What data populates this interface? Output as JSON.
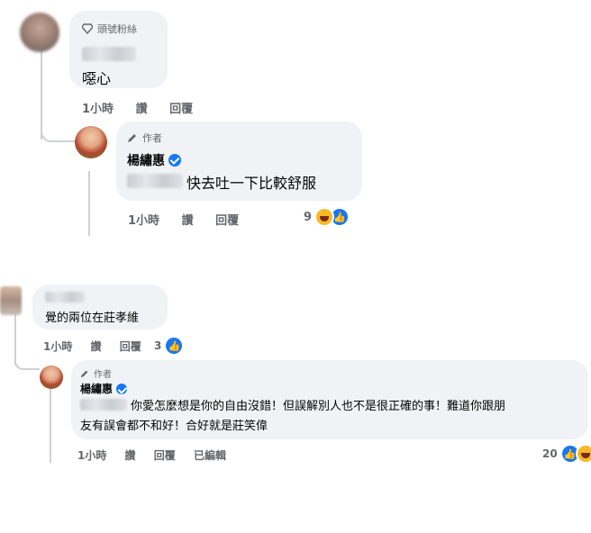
{
  "thread1": {
    "commenter": {
      "badge": "頭號粉絲",
      "text": "噁心",
      "actions": [
        "1小時",
        "讚",
        "回覆"
      ]
    },
    "reply": {
      "role": "作者",
      "name": "楊繡惠",
      "text": "快去吐一下比較舒服",
      "actions": [
        "1小時",
        "讚",
        "回覆"
      ],
      "reaction_count": "9"
    }
  },
  "thread2": {
    "commenter": {
      "text": "覺的兩位在莊孝維",
      "actions": [
        "1小時",
        "讚",
        "回覆"
      ],
      "reaction_count": "3"
    },
    "reply": {
      "role": "作者",
      "name": "楊繡惠",
      "text_line1": "你愛怎麼想是你的自由沒錯！但誤解別人也不是很正確的事！難道你跟朋",
      "text_line2": "友有誤會都不和好！合好就是莊笑偉",
      "actions": [
        "1小時",
        "讚",
        "回覆",
        "已編輯"
      ],
      "reaction_count": "20"
    }
  },
  "icons": {
    "diamond": "diamond-icon",
    "pen": "pen-icon",
    "verified": "verified-badge-icon",
    "like": "like-reaction-icon",
    "haha": "haha-reaction-icon"
  },
  "colors": {
    "bubble": "#f0f2f5",
    "meta": "#65676b",
    "accent": "#1877f2"
  }
}
